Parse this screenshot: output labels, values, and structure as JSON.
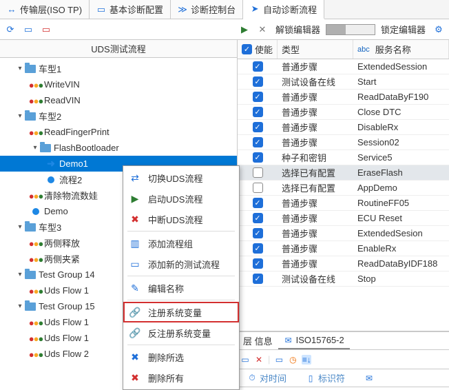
{
  "tabs": [
    {
      "label": "传输层(ISO TP)",
      "icon": "↔",
      "color": "#1e6fd9"
    },
    {
      "label": "基本诊断配置",
      "icon": "▭",
      "color": "#1e6fd9"
    },
    {
      "label": "诊断控制台",
      "icon": "≫",
      "color": "#1e6fd9"
    },
    {
      "label": "自动诊断流程",
      "icon": "➤",
      "color": "#1e6fd9",
      "active": true
    }
  ],
  "toolbar": {
    "unlock": "解锁编辑器",
    "lock": "锁定编辑器"
  },
  "left": {
    "title": "UDS测试流程",
    "tree": [
      {
        "level": 0,
        "type": "folder",
        "label": "车型1",
        "open": true
      },
      {
        "level": 1,
        "type": "dots",
        "label": "WriteVIN"
      },
      {
        "level": 1,
        "type": "dots",
        "label": "ReadVIN"
      },
      {
        "level": 0,
        "type": "folder",
        "label": "车型2",
        "open": true
      },
      {
        "level": 1,
        "type": "dots",
        "label": "ReadFingerPrint"
      },
      {
        "level": 1,
        "type": "folder",
        "label": "FlashBootloader",
        "open": true
      },
      {
        "level": 2,
        "type": "arrow",
        "label": "Demo1",
        "selected": true
      },
      {
        "level": 2,
        "type": "circle",
        "label": "流程2"
      },
      {
        "level": 1,
        "type": "dots",
        "label": "清除物流数娃"
      },
      {
        "level": 1,
        "type": "circle",
        "label": "Demo"
      },
      {
        "level": 0,
        "type": "folder",
        "label": "车型3",
        "open": true
      },
      {
        "level": 1,
        "type": "dots",
        "label": "两侧释放"
      },
      {
        "level": 1,
        "type": "dots",
        "label": "两侧夹紧"
      },
      {
        "level": 0,
        "type": "folder",
        "label": "Test Group 14",
        "open": true
      },
      {
        "level": 1,
        "type": "dots",
        "label": "Uds Flow 1"
      },
      {
        "level": 0,
        "type": "folder",
        "label": "Test Group 15",
        "open": true
      },
      {
        "level": 1,
        "type": "dots",
        "label": "Uds Flow 1"
      },
      {
        "level": 1,
        "type": "dots",
        "label": "Uds Flow 1"
      },
      {
        "level": 1,
        "type": "dots",
        "label": "Uds Flow 2"
      }
    ]
  },
  "ctx": [
    {
      "icon": "⇄",
      "cls": "blue",
      "label": "切换UDS流程"
    },
    {
      "icon": "▶",
      "cls": "green",
      "label": "启动UDS流程"
    },
    {
      "icon": "✖",
      "cls": "red",
      "label": "中断UDS流程",
      "sepAfter": true
    },
    {
      "icon": "▥",
      "cls": "blue",
      "label": "添加流程组"
    },
    {
      "icon": "▭",
      "cls": "blue",
      "label": "添加新的测试流程",
      "sepAfter": true
    },
    {
      "icon": "✎",
      "cls": "blue",
      "label": "编辑名称",
      "sepAfter": true
    },
    {
      "icon": "🔗",
      "cls": "gray",
      "label": "注册系统变量",
      "highlight": true
    },
    {
      "icon": "🔗",
      "cls": "gray",
      "label": "反注册系统变量",
      "sepAfter": true
    },
    {
      "icon": "✖",
      "cls": "blue",
      "label": "删除所选"
    },
    {
      "icon": "✖",
      "cls": "red",
      "label": "删除所有"
    }
  ],
  "grid": {
    "head": {
      "c1": "使能",
      "c2": "类型",
      "c3": "服务名称"
    },
    "rows": [
      {
        "en": true,
        "type": "普通步骤",
        "name": "ExtendedSession"
      },
      {
        "en": true,
        "type": "测试设备在线",
        "name": "Start"
      },
      {
        "en": true,
        "type": "普通步骤",
        "name": "ReadDataByF190"
      },
      {
        "en": true,
        "type": "普通步骤",
        "name": "Close DTC"
      },
      {
        "en": true,
        "type": "普通步骤",
        "name": "DisableRx"
      },
      {
        "en": true,
        "type": "普通步骤",
        "name": "Session02"
      },
      {
        "en": true,
        "type": "种子和密钥",
        "name": "Service5"
      },
      {
        "en": false,
        "type": "选择已有配置",
        "name": "EraseFlash",
        "sel": true
      },
      {
        "en": false,
        "type": "选择已有配置",
        "name": "AppDemo"
      },
      {
        "en": true,
        "type": "普通步骤",
        "name": "RoutineFF05"
      },
      {
        "en": true,
        "type": "普通步骤",
        "name": "ECU Reset"
      },
      {
        "en": true,
        "type": "普通步骤",
        "name": "ExtendedSesion"
      },
      {
        "en": true,
        "type": "普通步骤",
        "name": "EnableRx"
      },
      {
        "en": true,
        "type": "普通步骤",
        "name": "ReadDataByIDF188"
      },
      {
        "en": true,
        "type": "测试设备在线",
        "name": "Stop"
      }
    ]
  },
  "bottom": {
    "tabs": [
      {
        "label": "层 信息"
      },
      {
        "label": "ISO15765-2",
        "icon": "✉",
        "active": true
      }
    ],
    "cols": [
      {
        "label": "对时间",
        "icon": "⏱"
      },
      {
        "label": "标识符",
        "icon": "▯"
      }
    ]
  }
}
